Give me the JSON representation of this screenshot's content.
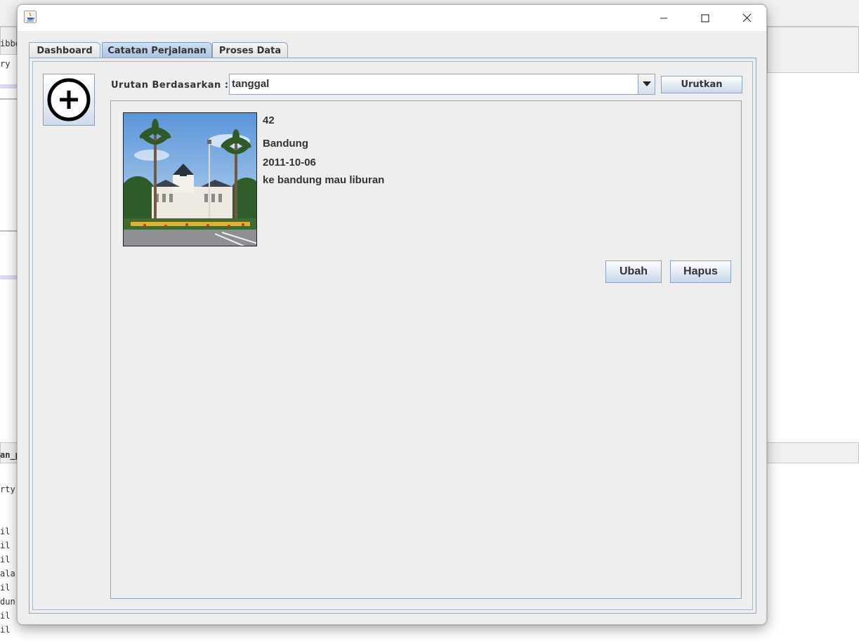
{
  "background": {
    "texts": [
      "ibbe",
      "ry",
      "an_p",
      "rty",
      "il",
      "il",
      "il",
      "ala",
      "il",
      "dun",
      "il",
      "il"
    ]
  },
  "window": {
    "title": "",
    "controls": {
      "minimize": "minimize",
      "maximize": "maximize",
      "close": "close"
    }
  },
  "tabs": [
    {
      "label": "Dashboard",
      "active": false
    },
    {
      "label": "Catatan Perjalanan",
      "active": true
    },
    {
      "label": "Proses Data",
      "active": false
    }
  ],
  "toolbar": {
    "add_icon": "plus-circle-icon",
    "sort_label": "Urutan Berdasarkan :",
    "sort_value": "tanggal",
    "sort_button": "Urutkan"
  },
  "entry": {
    "id": "42",
    "city": "Bandung",
    "date": "2011-10-06",
    "note": "ke bandung mau liburan",
    "photo": "bandung-photo",
    "edit_button": "Ubah",
    "delete_button": "Hapus"
  },
  "colors": {
    "accent_border": "#8fa3bd",
    "active_tab": "#a9c3e3",
    "panel_bg": "#eeeeee"
  }
}
